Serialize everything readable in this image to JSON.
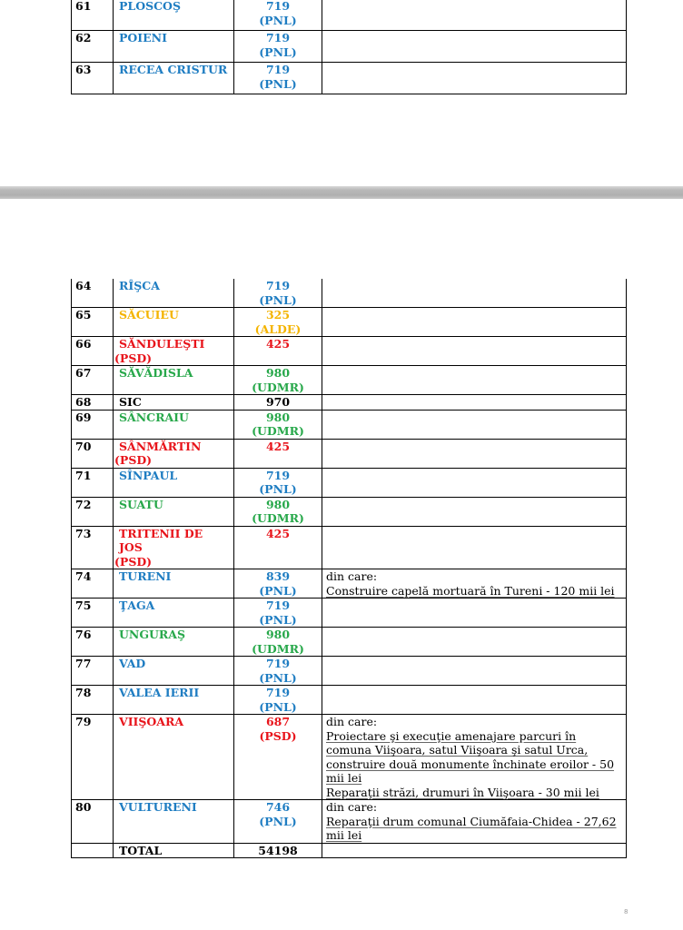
{
  "colors": {
    "pnl": "#1f7dc2",
    "udmr": "#28a84b",
    "psd": "#e8141b",
    "alde": "#f4b400",
    "neutral": "#000000"
  },
  "table_part1": [
    {
      "nr": "61",
      "name": "PLOSCOŞ",
      "name_party": "",
      "value": "719",
      "party": "(PNL)",
      "color": "pnl",
      "details": []
    },
    {
      "nr": "62",
      "name": "POIENI",
      "name_party": "",
      "value": "719",
      "party": "(PNL)",
      "color": "pnl",
      "details": []
    },
    {
      "nr": "63",
      "name": "RECEA CRISTUR",
      "name_party": "",
      "value": "719",
      "party": "(PNL)",
      "color": "pnl",
      "details": []
    }
  ],
  "table_part2": [
    {
      "nr": "64",
      "name": "RÎŞCA",
      "name_party": "",
      "value": "719",
      "party": "(PNL)",
      "color": "pnl",
      "details": []
    },
    {
      "nr": "65",
      "name": "SĂCUIEU",
      "name_party": "",
      "value": "325",
      "party": "(ALDE)",
      "color": "alde",
      "details": []
    },
    {
      "nr": "66",
      "name": "SĂNDULEŞTI",
      "name_party": "(PSD)",
      "value": "425",
      "party": "",
      "color": "psd",
      "details": []
    },
    {
      "nr": "67",
      "name": "SĂVĂDISLA",
      "name_party": "",
      "value": "980",
      "party": "(UDMR)",
      "color": "udmr",
      "details": []
    },
    {
      "nr": "68",
      "name": "SIC",
      "name_party": "",
      "value": "970",
      "party": "",
      "color": "neutral",
      "details": []
    },
    {
      "nr": "69",
      "name": "SÂNCRAIU",
      "name_party": "",
      "value": "980",
      "party": "(UDMR)",
      "color": "udmr",
      "details": []
    },
    {
      "nr": "70",
      "name": "SÂNMĂRTIN",
      "name_party": "(PSD)",
      "value": "425",
      "party": "",
      "color": "psd",
      "details": []
    },
    {
      "nr": "71",
      "name": "SÎNPAUL",
      "name_party": "",
      "value": "719",
      "party": "(PNL)",
      "color": "pnl",
      "details": []
    },
    {
      "nr": "72",
      "name": "SUATU",
      "name_party": "",
      "value": "980",
      "party": "(UDMR)",
      "color": "udmr",
      "details": []
    },
    {
      "nr": "73",
      "name": "TRITENII DE JOS",
      "name_party": "(PSD)",
      "value": "425",
      "party": "",
      "color": "psd",
      "details": []
    },
    {
      "nr": "74",
      "name": "TURENI",
      "name_party": "",
      "value": "839",
      "party": "(PNL)",
      "color": "pnl",
      "details": [
        "din care:",
        "Construire capelă mortuară în Tureni - 120 mii lei"
      ]
    },
    {
      "nr": "75",
      "name": "ŢAGA",
      "name_party": "",
      "value": "719",
      "party": "(PNL)",
      "color": "pnl",
      "details": []
    },
    {
      "nr": "76",
      "name": "UNGURAŞ",
      "name_party": "",
      "value": "980",
      "party": "(UDMR)",
      "color": "udmr",
      "details": []
    },
    {
      "nr": "77",
      "name": "VAD",
      "name_party": "",
      "value": "719",
      "party": "(PNL)",
      "color": "pnl",
      "details": []
    },
    {
      "nr": "78",
      "name": "VALEA IERII",
      "name_party": "",
      "value": "719",
      "party": "(PNL)",
      "color": "pnl",
      "details": []
    },
    {
      "nr": "79",
      "name": "VIIŞOARA",
      "name_party": "",
      "value": "687",
      "party": "(PSD)",
      "color": "psd",
      "details": [
        "din care:",
        "Proiectare şi execuţie amenajare parcuri în comuna Viişoara, satul Viişoara şi satul Urca, construire două monumente închinate eroilor  - 50 mii lei",
        "Reparaţii străzi, drumuri în Viişoara - 30 mii lei"
      ]
    },
    {
      "nr": "80",
      "name": "VULTURENI",
      "name_party": "",
      "value": "746",
      "party": "(PNL)",
      "color": "pnl",
      "details": [
        "din care:",
        "Reparaţii drum comunal Ciumăfaia-Chidea - 27,62 mii lei"
      ]
    }
  ],
  "total": {
    "nr": "",
    "label": "TOTAL",
    "value": "54198"
  },
  "page_number": "8"
}
